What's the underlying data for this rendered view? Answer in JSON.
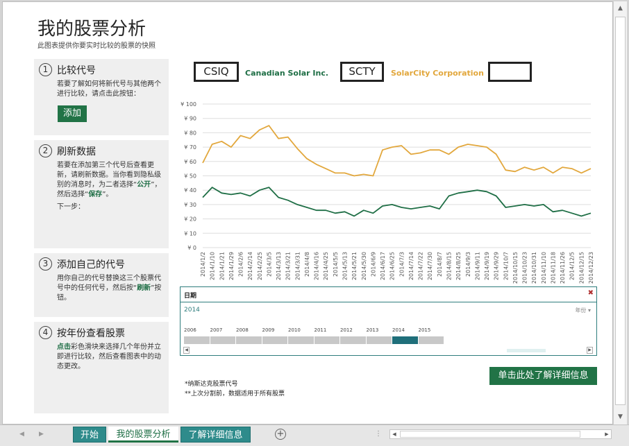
{
  "page": {
    "title": "我的股票分析",
    "subtitle": "此图表提供你要实时比较的股票的快照"
  },
  "steps": [
    {
      "num": "1",
      "title": "比较代号",
      "body": "若要了解如何将新代号与其他两个进行比较，请点击此按钮：",
      "button": "添加"
    },
    {
      "num": "2",
      "title": "刷新数据",
      "body1": "若要在添加第三个代号后查看更新，请刷新数据。当你看到隐私级别的消息时，为二者选择“",
      "bold1": "公开",
      "body2": "”，然后选择“",
      "bold2": "保存",
      "body3": "”。",
      "next": "下一步："
    },
    {
      "num": "3",
      "title": "添加自己的代号",
      "body1": "用你自己的代号替换这三个股票代号中的任何代号，然后按“",
      "bold1": "刷新",
      "body2": "”按钮。"
    },
    {
      "num": "4",
      "title": "按年份查看股票",
      "bold1": "点击",
      "body1": "彩色滑块来选择几个年份并立即进行比较，然后查看图表中的动态更改。"
    }
  ],
  "tickers": [
    {
      "symbol": "CSIQ",
      "name": "Canadian Solar Inc.",
      "color": "#1e6e45"
    },
    {
      "symbol": "SCTY",
      "name": "SolarCity Corporation",
      "color": "#e2a73c"
    },
    {
      "symbol": "",
      "name": "",
      "color": ""
    }
  ],
  "chart_data": {
    "type": "line",
    "title": "",
    "xlabel": "",
    "ylabel": "",
    "ylim": [
      0,
      100
    ],
    "yticks": [
      "¥ 0",
      "¥ 10",
      "¥ 20",
      "¥ 30",
      "¥ 40",
      "¥ 50",
      "¥ 60",
      "¥ 70",
      "¥ 80",
      "¥ 90",
      "¥ 100"
    ],
    "grid": true,
    "legend": "none",
    "categories": [
      "2014/1/2",
      "2014/1/10",
      "2014/1/21",
      "2014/1/29",
      "2014/2/6",
      "2014/2/14",
      "2014/2/25",
      "2014/3/5",
      "2014/3/13",
      "2014/3/21",
      "2014/3/31",
      "2014/4/8",
      "2014/4/16",
      "2014/4/25",
      "2014/5/5",
      "2014/5/13",
      "2014/5/21",
      "2014/5/30",
      "2014/6/9",
      "2014/6/17",
      "2014/6/25",
      "2014/7/3",
      "2014/7/14",
      "2014/7/22",
      "2014/7/30",
      "2014/8/7",
      "2014/8/15",
      "2014/8/25",
      "2014/9/3",
      "2014/9/11",
      "2014/9/19",
      "2014/9/29",
      "2014/10/7",
      "2014/10/15",
      "2014/10/23",
      "2014/10/31",
      "2014/11/10",
      "2014/11/18",
      "2014/11/26",
      "2014/12/5",
      "2014/12/15",
      "2014/12/23"
    ],
    "series": [
      {
        "name": "SCTY",
        "color": "#e2a73c",
        "values": [
          59,
          72,
          74,
          70,
          78,
          76,
          82,
          85,
          76,
          77,
          69,
          62,
          58,
          55,
          52,
          52,
          50,
          51,
          50,
          68,
          70,
          71,
          65,
          66,
          68,
          68,
          65,
          70,
          72,
          71,
          70,
          65,
          54,
          53,
          56,
          54,
          56,
          52,
          56,
          55,
          52,
          55
        ]
      },
      {
        "name": "CSIQ",
        "color": "#1e6e45",
        "values": [
          35,
          42,
          38,
          37,
          38,
          36,
          40,
          42,
          35,
          33,
          30,
          28,
          26,
          26,
          24,
          25,
          22,
          26,
          24,
          29,
          30,
          28,
          27,
          28,
          29,
          27,
          36,
          38,
          39,
          40,
          39,
          36,
          28,
          29,
          30,
          29,
          30,
          25,
          26,
          24,
          22,
          24
        ]
      }
    ]
  },
  "timeline": {
    "header": "日期",
    "selected": "2014",
    "unit": "年份 ▾",
    "years": [
      "2006",
      "2007",
      "2008",
      "2009",
      "2010",
      "2011",
      "2012",
      "2013",
      "2014",
      "2015"
    ],
    "active_year": "2014"
  },
  "more_button": "单击此处了解详细信息",
  "footnotes": [
    "*纳斯达克股票代号",
    "**上次分割前，数据适用于所有股票"
  ],
  "tabs": [
    {
      "label": "开始",
      "style": "green"
    },
    {
      "label": "我的股票分析",
      "style": "active"
    },
    {
      "label": "了解详细信息",
      "style": "green"
    }
  ],
  "colors": {
    "accent": "#217346",
    "tab_green": "#2e8b8b"
  }
}
